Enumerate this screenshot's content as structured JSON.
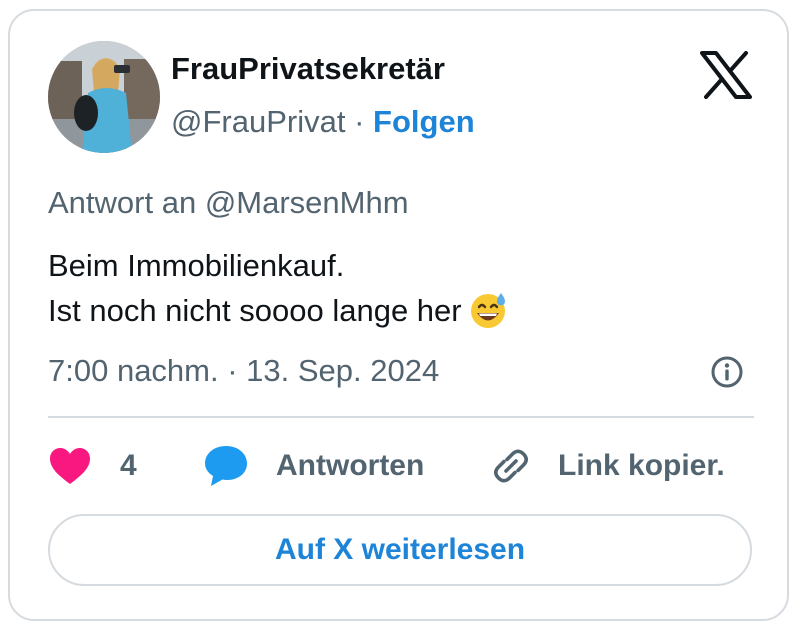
{
  "author": {
    "display_name": "FrauPrivatsekretär",
    "handle": "@FrauPrivat",
    "separator": "·",
    "follow_label": "Folgen"
  },
  "tweet": {
    "reply_prefix": "Antwort an",
    "reply_handle": "@MarsenMhm",
    "lines": [
      "Beim Immobilienkauf.",
      "Ist noch nicht soooo lange her"
    ],
    "emoji_icon": "grinning-face-with-sweat-emoji",
    "timestamp": "7:00 nachm. · 13. Sep. 2024"
  },
  "actions": {
    "like_count": "4",
    "reply_label": "Antworten",
    "copy_link_label": "Link kopier."
  },
  "read_more_label": "Auf X weiterlesen",
  "colors": {
    "accent": "#1d84d8",
    "like": "#f91880",
    "reply_icon": "#1d9bf0",
    "text": "#0f1419",
    "secondary_text": "#536471",
    "border": "#d6dbe0"
  },
  "icons": {
    "brand": "x-logo-icon",
    "info": "info-icon",
    "like": "heart-icon",
    "reply": "speech-bubble-icon",
    "copy_link": "link-icon"
  }
}
